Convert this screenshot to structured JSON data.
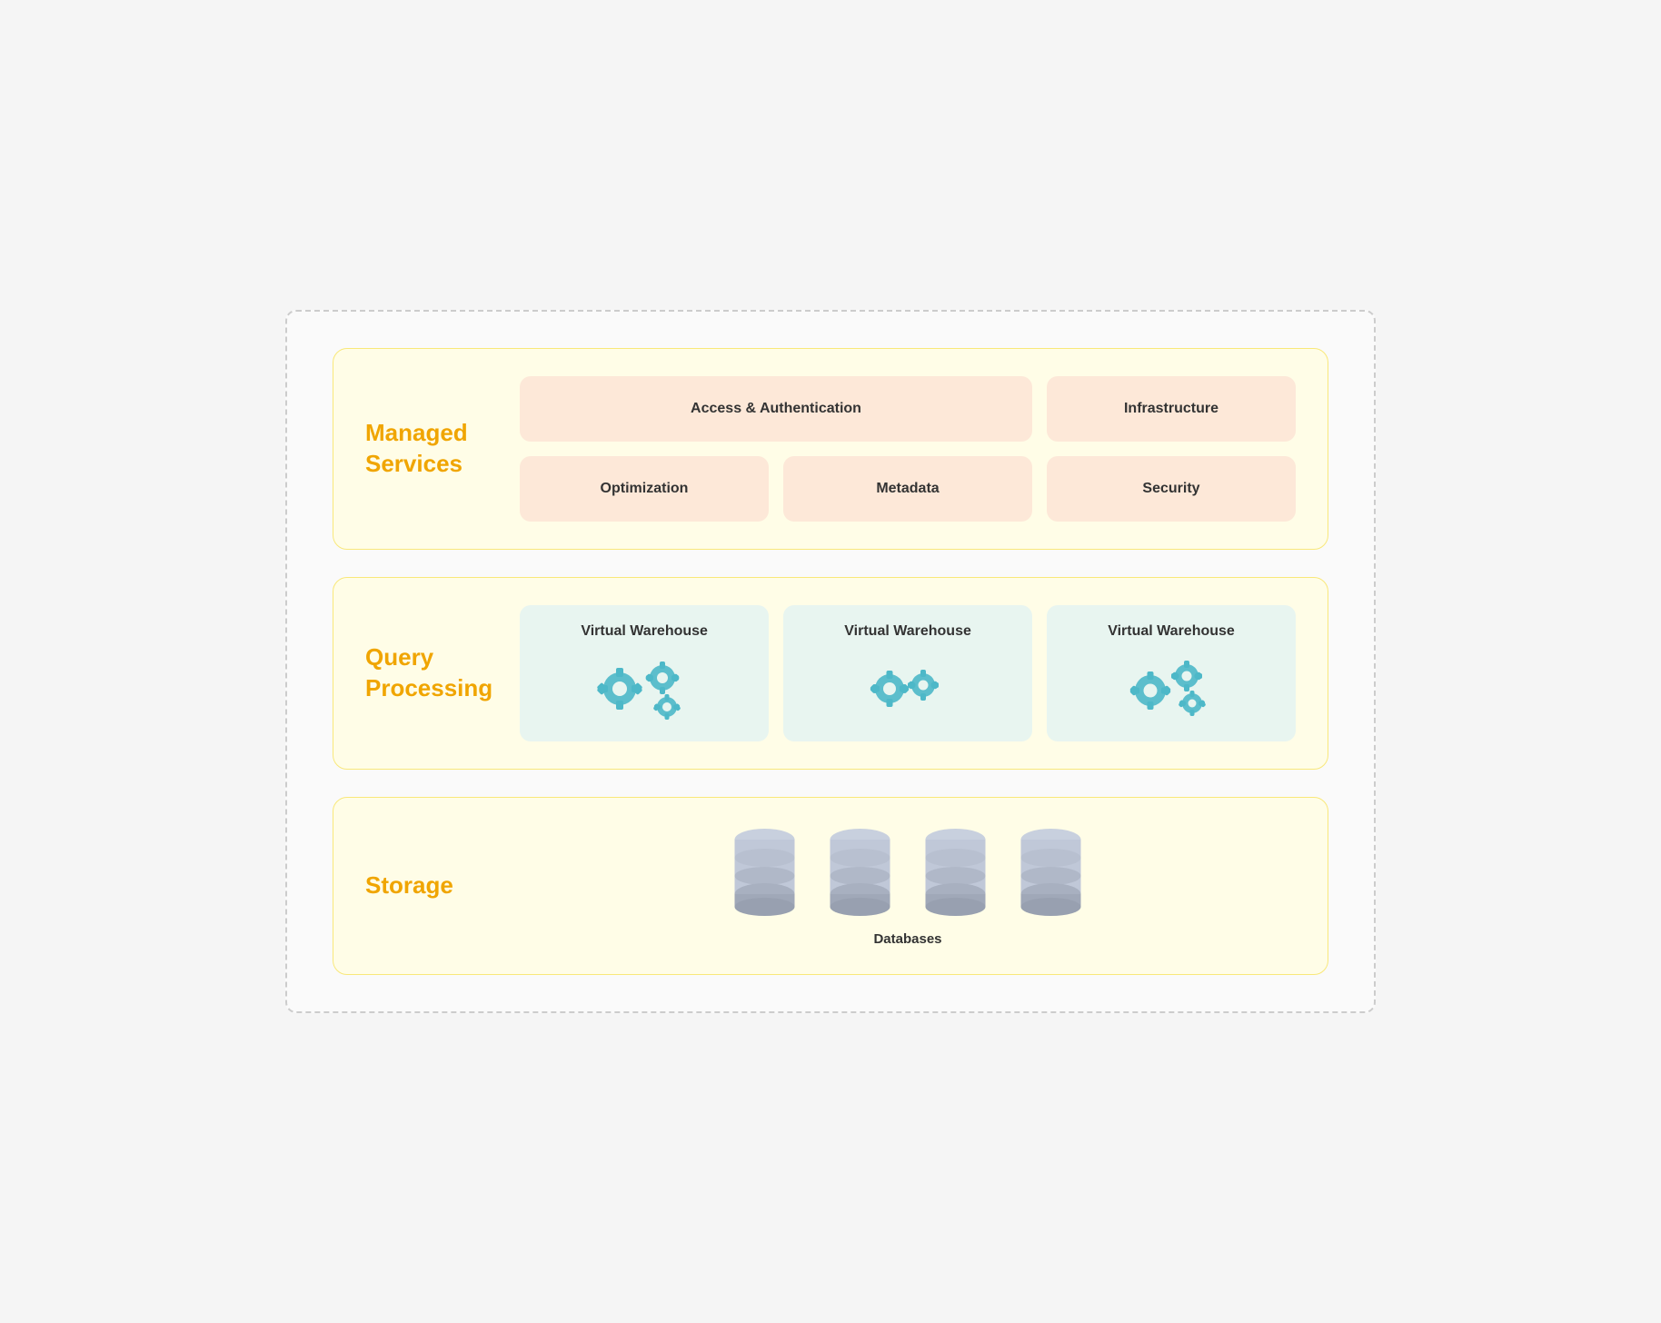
{
  "managed_services": {
    "section_label_line1": "Managed",
    "section_label_line2": "Services",
    "cards": [
      {
        "id": "access-auth",
        "label": "Access & Authentication",
        "wide": true
      },
      {
        "id": "infrastructure",
        "label": "Infrastructure",
        "wide": false
      },
      {
        "id": "optimization",
        "label": "Optimization",
        "wide": false
      },
      {
        "id": "metadata",
        "label": "Metadata",
        "wide": false
      },
      {
        "id": "security",
        "label": "Security",
        "wide": false
      }
    ]
  },
  "query_processing": {
    "section_label_line1": "Query",
    "section_label_line2": "Processing",
    "warehouses": [
      {
        "id": "vw1",
        "label": "Virtual Warehouse"
      },
      {
        "id": "vw2",
        "label": "Virtual Warehouse"
      },
      {
        "id": "vw3",
        "label": "Virtual Warehouse"
      }
    ]
  },
  "storage": {
    "section_label": "Storage",
    "db_label": "Databases",
    "db_count": 4
  },
  "colors": {
    "section_title": "#f0a500",
    "managed_card_bg": "#fde8d8",
    "warehouse_card_bg": "#e8f5f0",
    "gear_color": "#4db8c8",
    "db_color": "#b0b8c8"
  }
}
